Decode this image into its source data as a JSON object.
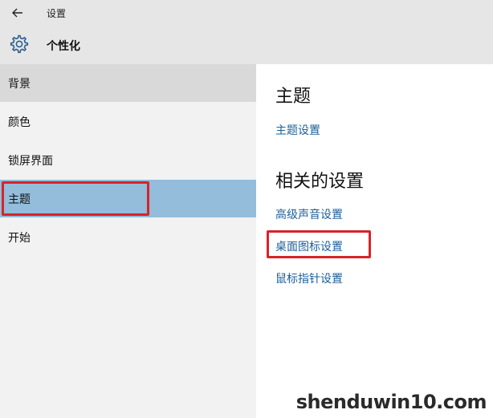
{
  "window": {
    "title": "设置"
  },
  "header": {
    "title": "个性化"
  },
  "sidebar": {
    "items": [
      {
        "label": "背景"
      },
      {
        "label": "颜色"
      },
      {
        "label": "锁屏界面"
      },
      {
        "label": "主题"
      },
      {
        "label": "开始"
      }
    ]
  },
  "main": {
    "theme_heading": "主题",
    "theme_settings_link": "主题设置",
    "related_heading": "相关的设置",
    "related_links": [
      {
        "label": "高级声音设置"
      },
      {
        "label": "桌面图标设置"
      },
      {
        "label": "鼠标指针设置"
      }
    ]
  },
  "watermark": "shenduwin10.com",
  "colors": {
    "accent_link": "#1c5f9a",
    "selected_bg": "#94bcdb",
    "annotation": "#d6242a"
  }
}
